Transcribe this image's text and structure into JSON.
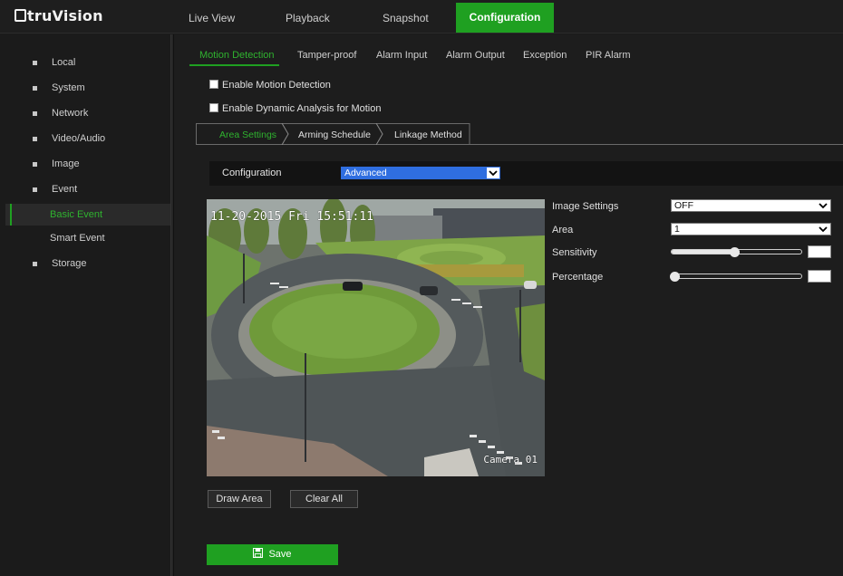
{
  "brand": {
    "logo_text": "truVision"
  },
  "topnav": {
    "tabs": [
      {
        "label": "Live View"
      },
      {
        "label": "Playback"
      },
      {
        "label": "Snapshot"
      },
      {
        "label": "Configuration",
        "active": true
      }
    ]
  },
  "sidebar": {
    "items": [
      {
        "label": "Local"
      },
      {
        "label": "System"
      },
      {
        "label": "Network"
      },
      {
        "label": "Video/Audio"
      },
      {
        "label": "Image"
      },
      {
        "label": "Event"
      },
      {
        "label": "Basic Event",
        "active": true
      },
      {
        "label": "Smart Event"
      },
      {
        "label": "Storage"
      }
    ]
  },
  "subtabs": [
    {
      "label": "Motion Detection",
      "active": true
    },
    {
      "label": "Tamper-proof"
    },
    {
      "label": "Alarm Input"
    },
    {
      "label": "Alarm Output"
    },
    {
      "label": "Exception"
    },
    {
      "label": "PIR Alarm"
    }
  ],
  "checkboxes": {
    "enable_motion": {
      "label": "Enable Motion Detection",
      "checked": false
    },
    "enable_dynamic": {
      "label": "Enable Dynamic Analysis for Motion",
      "checked": false
    }
  },
  "steps": [
    {
      "label": "Area Settings",
      "active": true
    },
    {
      "label": "Arming Schedule"
    },
    {
      "label": "Linkage Method"
    }
  ],
  "configuration": {
    "label": "Configuration",
    "value": "Advanced"
  },
  "video": {
    "timestamp": "11-20-2015 Fri 15:51:11",
    "camera_name": "Camera 01"
  },
  "settings": {
    "image_settings": {
      "label": "Image Settings",
      "value": "OFF"
    },
    "area": {
      "label": "Area",
      "value": "1"
    },
    "sensitivity": {
      "label": "Sensitivity",
      "level": 0.48
    },
    "percentage": {
      "label": "Percentage",
      "level": 0.03
    }
  },
  "buttons": {
    "draw_area": "Draw Area",
    "clear_all": "Clear All",
    "save": "Save"
  },
  "colors": {
    "accent": "#1fa021",
    "select_blue": "#2f6ee0",
    "background": "#1b1b1b"
  }
}
